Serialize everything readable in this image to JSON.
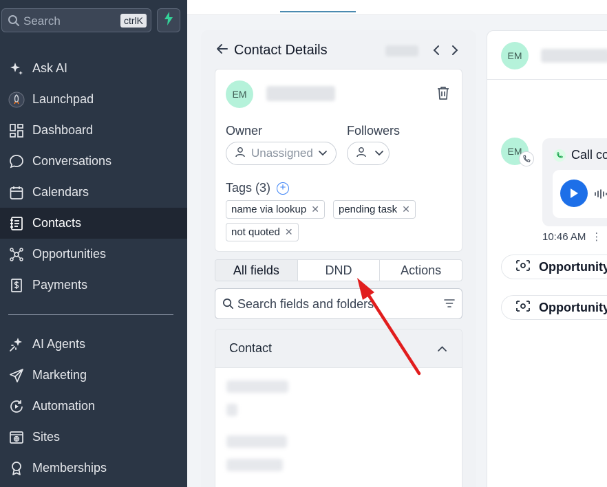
{
  "sidebar": {
    "search_placeholder": "Search",
    "shortcut": "ctrlK",
    "items_top": [
      {
        "label": "Ask AI",
        "icon": "sparkle-icon"
      },
      {
        "label": "Launchpad",
        "icon": "rocket-icon"
      },
      {
        "label": "Dashboard",
        "icon": "dashboard-icon"
      },
      {
        "label": "Conversations",
        "icon": "chat-bubble-icon"
      },
      {
        "label": "Calendars",
        "icon": "calendar-icon"
      },
      {
        "label": "Contacts",
        "icon": "contact-book-icon",
        "active": true
      },
      {
        "label": "Opportunities",
        "icon": "opportunities-icon"
      },
      {
        "label": "Payments",
        "icon": "payments-icon"
      }
    ],
    "items_bottom": [
      {
        "label": "AI Agents",
        "icon": "ai-agents-icon"
      },
      {
        "label": "Marketing",
        "icon": "send-icon"
      },
      {
        "label": "Automation",
        "icon": "automation-icon"
      },
      {
        "label": "Sites",
        "icon": "sites-icon"
      },
      {
        "label": "Memberships",
        "icon": "award-icon"
      }
    ]
  },
  "contact_panel": {
    "title": "Contact Details",
    "avatar_initials": "EM",
    "owner_label": "Owner",
    "owner_value": "Unassigned",
    "followers_label": "Followers",
    "tags_label": "Tags (3)",
    "tags": [
      "name via lookup",
      "pending task",
      "not quoted"
    ],
    "tabs": [
      "All fields",
      "DND",
      "Actions"
    ],
    "active_tab": "All fields",
    "field_search_placeholder": "Search fields and folders",
    "section_title": "Contact"
  },
  "conversation": {
    "avatar_initials": "EM",
    "message_avatar_initials": "EM",
    "call_label": "Call co",
    "message_time": "10:46 AM",
    "opportunity_pills": [
      "Opportunity",
      "Opportunity"
    ]
  },
  "colors": {
    "sidebar_bg": "#2b3645",
    "active_item_bg": "#1f2632",
    "avatar_bg": "#b5f2da",
    "accent_blue": "#1d6fe8",
    "bolt_green": "#34d399",
    "arrow_red": "#e11d1d"
  }
}
